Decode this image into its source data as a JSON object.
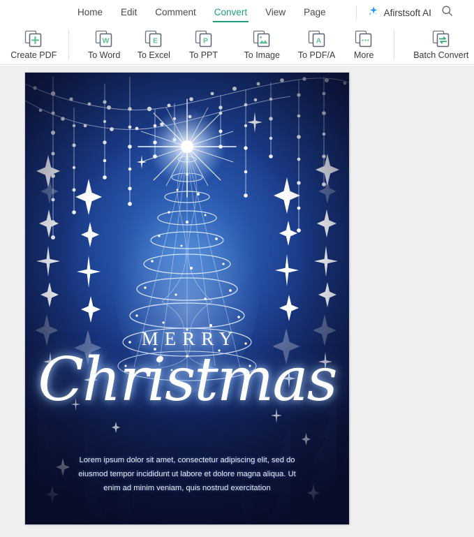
{
  "menubar": {
    "tabs": [
      {
        "label": "Home",
        "active": false
      },
      {
        "label": "Edit",
        "active": false
      },
      {
        "label": "Comment",
        "active": false
      },
      {
        "label": "Convert",
        "active": true
      },
      {
        "label": "View",
        "active": false
      },
      {
        "label": "Page",
        "active": false
      }
    ],
    "ai_button_label": "Afirstsoft AI",
    "ai_icon": "sparkle-icon",
    "search_icon": "search-icon",
    "accent_color": "#1f9e7e",
    "ai_icon_color": "#2196f3"
  },
  "ribbon": {
    "items": [
      {
        "label": "Create PDF",
        "icon": "create-pdf-icon",
        "glyph": "+"
      },
      {
        "label": "To Word",
        "icon": "to-word-icon",
        "glyph": "W"
      },
      {
        "label": "To Excel",
        "icon": "to-excel-icon",
        "glyph": "E"
      },
      {
        "label": "To PPT",
        "icon": "to-ppt-icon",
        "glyph": "P"
      },
      {
        "label": "To Image",
        "icon": "to-image-icon",
        "glyph": "image"
      },
      {
        "label": "To PDF/A",
        "icon": "to-pdfa-icon",
        "glyph": "A"
      },
      {
        "label": "More",
        "icon": "more-icon",
        "glyph": "..."
      },
      {
        "label": "Batch Convert",
        "icon": "batch-convert-icon",
        "glyph": "swap"
      }
    ],
    "icon_accent": "#5cbf92",
    "icon_outline": "#5a6472"
  },
  "document": {
    "poster": {
      "headline_top": "MERRY",
      "headline_script": "Christmas",
      "body_text": "Lorem ipsum dolor sit amet, consectetur adipiscing elit, sed do eiusmod tempor incididunt ut labore et dolore magna aliqua. Ut enim ad minim veniam, quis nostrud exercitation",
      "background_color": "#14265f",
      "accent_color": "#ffffff"
    }
  }
}
